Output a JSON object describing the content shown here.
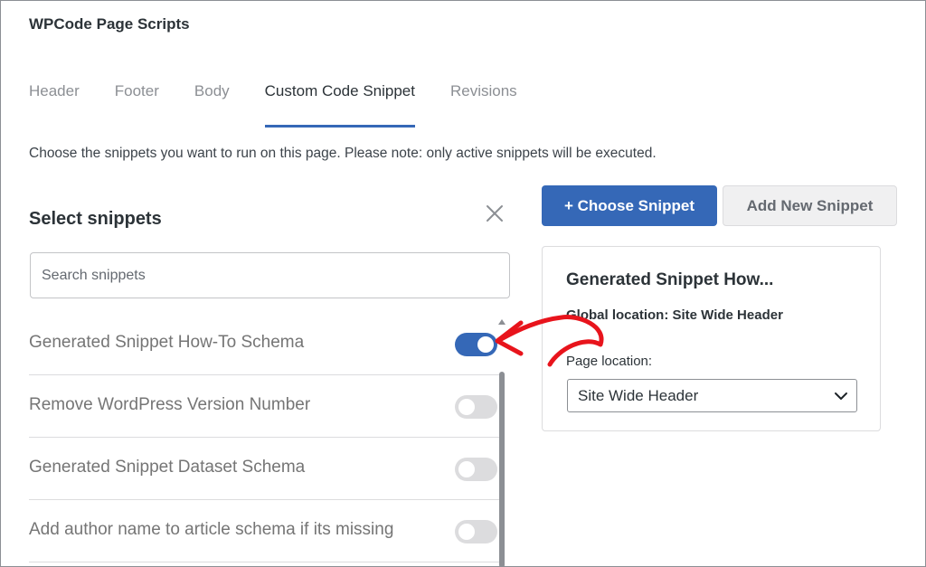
{
  "window": {
    "title": "WPCode Page Scripts"
  },
  "tabs": [
    {
      "label": "Header",
      "active": false
    },
    {
      "label": "Footer",
      "active": false
    },
    {
      "label": "Body",
      "active": false
    },
    {
      "label": "Custom Code Snippet",
      "active": true
    },
    {
      "label": "Revisions",
      "active": false
    }
  ],
  "note": "Choose the snippets you want to run on this page. Please note: only active snippets will be executed.",
  "selector": {
    "title": "Select snippets",
    "search_placeholder": "Search snippets",
    "items": [
      {
        "label": "Generated Snippet How-To Schema",
        "enabled": true
      },
      {
        "label": "Remove WordPress Version Number",
        "enabled": false
      },
      {
        "label": "Generated Snippet Dataset Schema",
        "enabled": false
      },
      {
        "label": "Add author name to article schema if its missing",
        "enabled": false
      }
    ]
  },
  "actions": {
    "choose_label": "+ Choose Snippet",
    "add_new_label": "Add New Snippet"
  },
  "card": {
    "title": "Generated Snippet How...",
    "global_location": "Global location: Site Wide Header",
    "page_location_label": "Page location:",
    "page_location_value": "Site Wide Header"
  },
  "colors": {
    "accent": "#3568b7",
    "annotation": "#e8141c"
  }
}
